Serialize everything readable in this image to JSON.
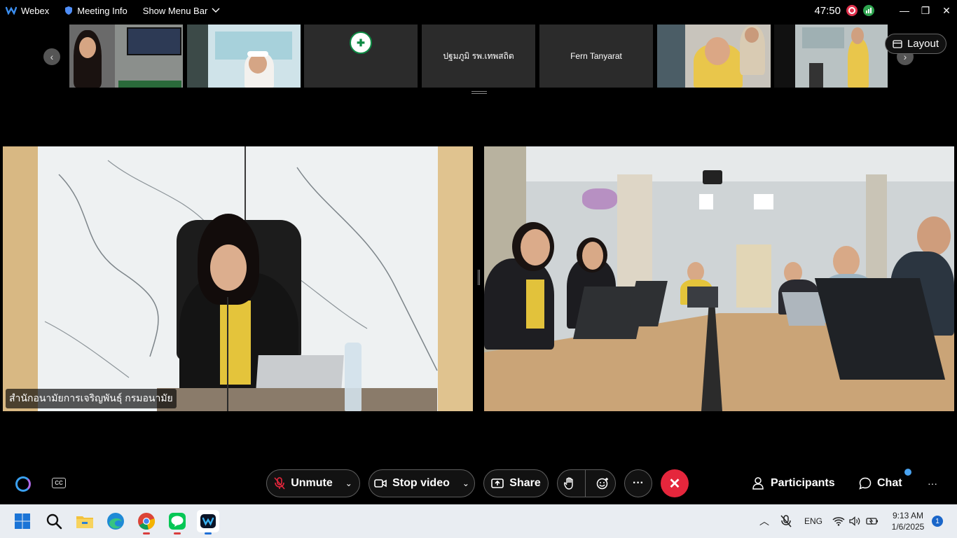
{
  "window": {
    "app_name": "Webex",
    "meeting_info": "Meeting Info",
    "show_menu_bar": "Show Menu Bar",
    "timer": "47:50",
    "minimize": "—",
    "restore": "❐",
    "close": "✕"
  },
  "filmstrip": {
    "participants": [
      {
        "name": ""
      },
      {
        "name": ""
      },
      {
        "name": ""
      },
      {
        "name": "ปฐมภูมิ รพ.เทพสถิต"
      },
      {
        "name": "Fern Tanyarat"
      },
      {
        "name": ""
      },
      {
        "name": ""
      }
    ],
    "layout_label": "Layout",
    "prev_arrow": "‹",
    "next_arrow": "›"
  },
  "main_video": {
    "left_name": "สำนักอนามัยการเจริญพันธุ์ กรมอนามัย"
  },
  "controls": {
    "unmute_label": "Unmute",
    "stop_video_label": "Stop video",
    "share_label": "Share",
    "more_label": "···",
    "end_label": "✕",
    "participants_label": "Participants",
    "chat_label": "Chat",
    "overflow_label": "···",
    "cc_label": "CC"
  },
  "taskbar": {
    "language": "ENG",
    "time": "9:13 AM",
    "date": "1/6/2025",
    "notification_count": "1"
  },
  "colors": {
    "end_call": "#e5263c",
    "recording": "#e0324d",
    "stats": "#2ea44f",
    "taskbar": "#e9edf2"
  }
}
